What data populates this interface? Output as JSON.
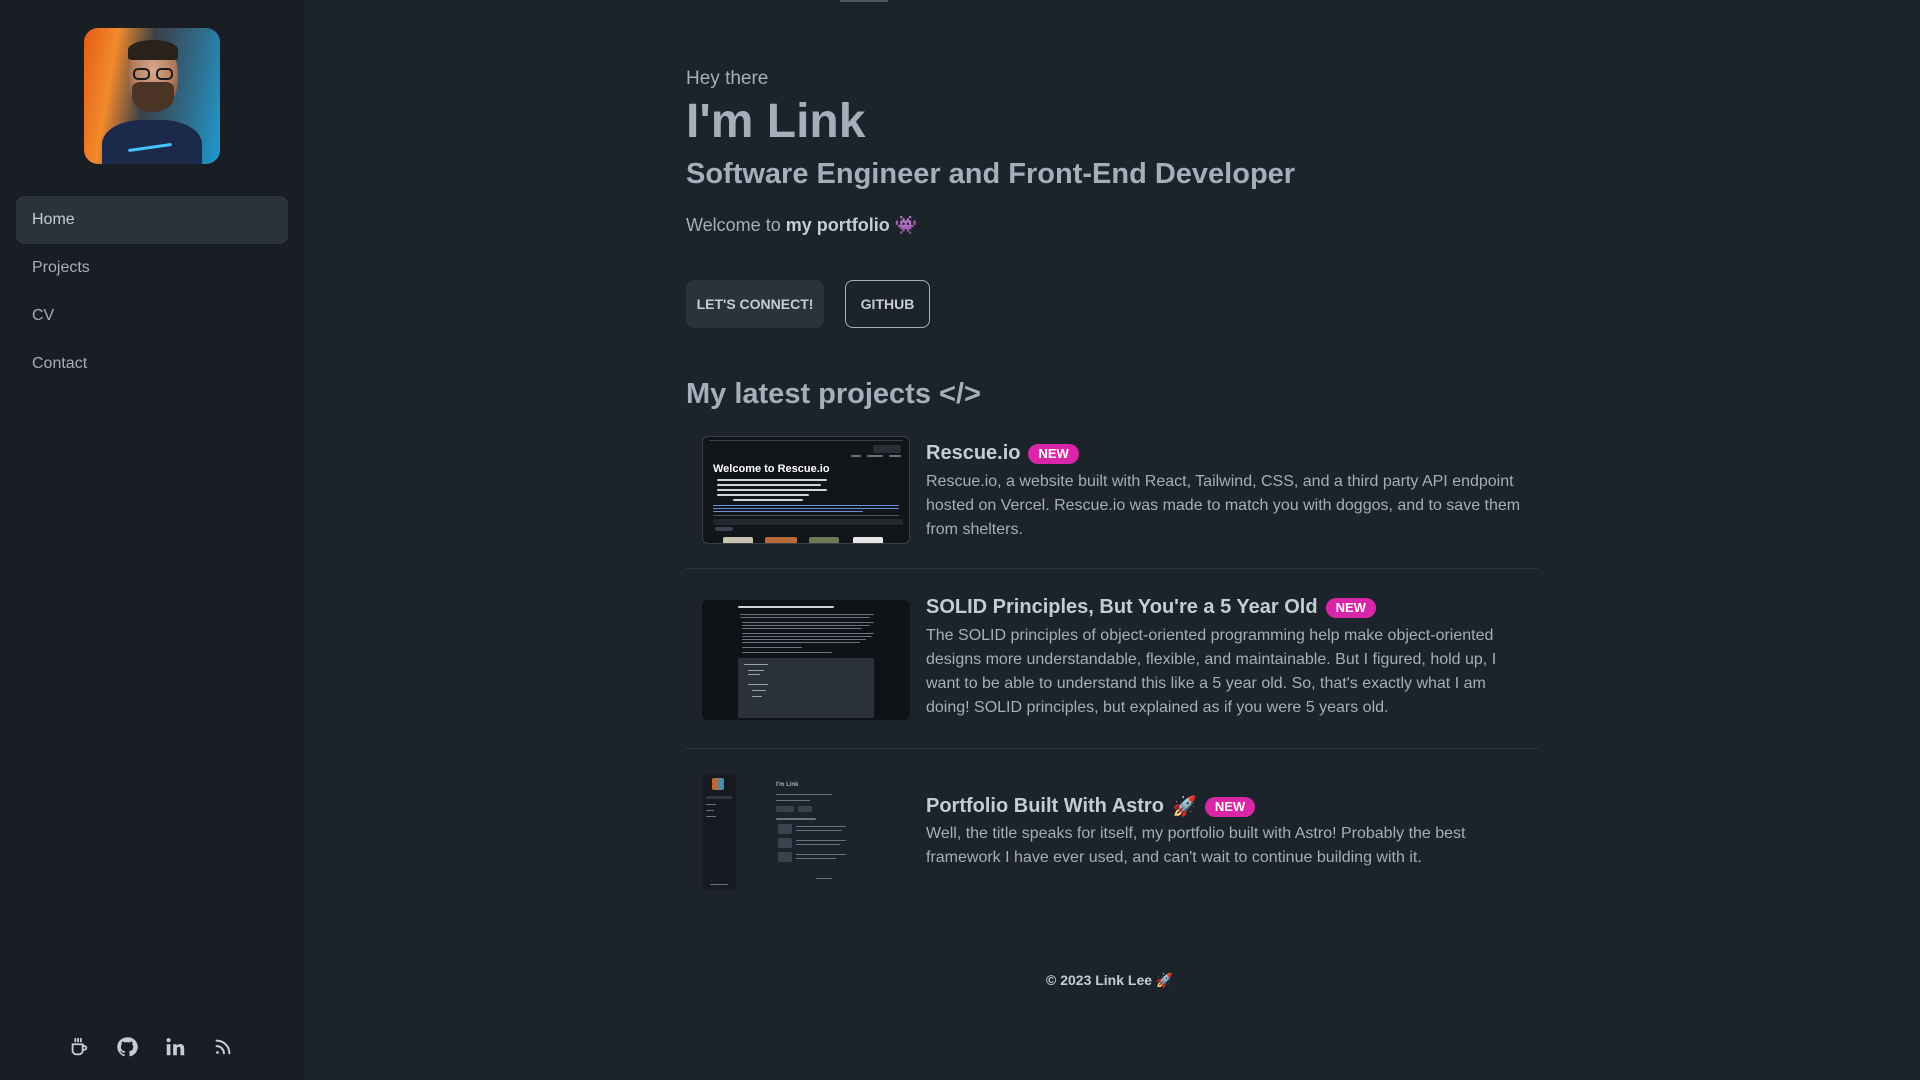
{
  "sidebar": {
    "nav": [
      {
        "label": "Home",
        "active": true
      },
      {
        "label": "Projects",
        "active": false
      },
      {
        "label": "CV",
        "active": false
      },
      {
        "label": "Contact",
        "active": false
      }
    ],
    "socials": [
      "coffee-icon",
      "github-icon",
      "linkedin-icon",
      "rss-icon"
    ]
  },
  "hero": {
    "greeting": "Hey there",
    "name": "I'm Link",
    "role": "Software Engineer and Front-End Developer",
    "welcome_prefix": "Welcome to ",
    "welcome_bold": "my portfolio",
    "welcome_emoji": "👾",
    "buttons": {
      "connect": "LET'S CONNECT!",
      "github": "GITHUB"
    }
  },
  "projects": {
    "heading": "My latest projects </>",
    "items": [
      {
        "title": "Rescue.io",
        "badge": "NEW",
        "description": "Rescue.io, a website built with React, Tailwind, CSS, and a third party API endpoint hosted on Vercel. Rescue.io was made to match you with doggos, and to save them from shelters.",
        "thumb_heading": "Welcome to Rescue.io"
      },
      {
        "title": "SOLID Principles, But You're a 5 Year Old",
        "badge": "NEW",
        "description": "The SOLID principles of object-oriented programming help make object-oriented designs more understandable, flexible, and maintainable. But I figured, hold up, I want to be able to understand this like a 5 year old. So, that's exactly what I am doing! SOLID principles, but explained as if you were 5 years old."
      },
      {
        "title": "Portfolio Built With Astro",
        "title_emoji": "🚀",
        "badge": "NEW",
        "description": "Well, the title speaks for itself, my portfolio built with Astro! Probably the best framework I have ever used, and can't wait to continue building with it.",
        "thumb_heading": "I'm Link"
      }
    ]
  },
  "footer": {
    "text": "© 2023 Link Lee 🚀"
  },
  "colors": {
    "background": "#1d232a",
    "sidebar": "#191e24",
    "active_nav": "#2a323c",
    "badge": "#d926a9",
    "text": "#a6adbb"
  }
}
